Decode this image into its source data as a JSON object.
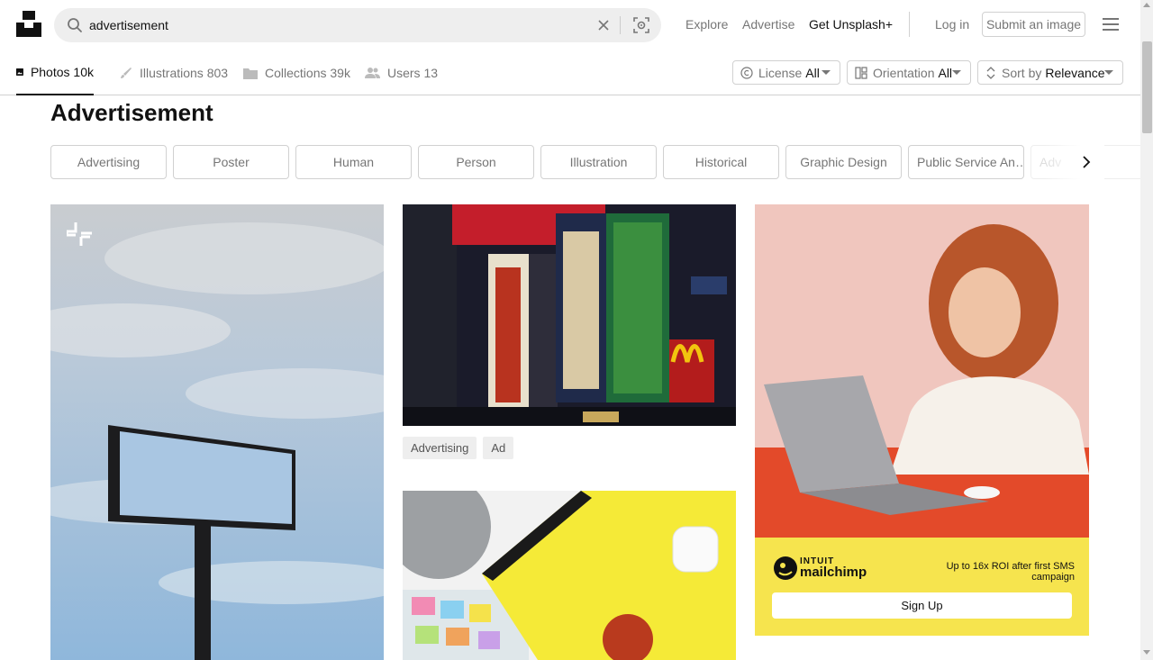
{
  "header": {
    "search_value": "advertisement",
    "nav": {
      "explore": "Explore",
      "advertise": "Advertise",
      "get_plus": "Get Unsplash+",
      "login": "Log in",
      "submit": "Submit an image"
    }
  },
  "tabs": [
    {
      "label": "Photos",
      "count": "10k",
      "icon": "photo-icon"
    },
    {
      "label": "Illustrations",
      "count": "803",
      "icon": "brush-icon"
    },
    {
      "label": "Collections",
      "count": "39k",
      "icon": "folder-icon"
    },
    {
      "label": "Users",
      "count": "13",
      "icon": "users-icon"
    }
  ],
  "filters": {
    "license": {
      "label": "License",
      "value": "All",
      "icon": "copyright-icon"
    },
    "orientation": {
      "label": "Orientation",
      "value": "All",
      "icon": "layout-icon"
    },
    "sort": {
      "label": "Sort by",
      "value": "Relevance",
      "icon": "sort-icon"
    }
  },
  "page_title": "Advertisement",
  "related": [
    "Advertising",
    "Poster",
    "Human",
    "Person",
    "Illustration",
    "Historical",
    "Graphic Design",
    "Public Service An…",
    "Adv"
  ],
  "photo_tags": [
    "Advertising",
    "Ad"
  ],
  "ad": {
    "brand_line1": "INTUIT",
    "brand_line2": "mailchimp",
    "tagline": "Up to 16x ROI after first SMS campaign",
    "cta": "Sign Up",
    "background": "#f6e44e"
  },
  "colors": {
    "accent": "#111111",
    "muted": "#767676",
    "border": "#d1d1d1"
  }
}
